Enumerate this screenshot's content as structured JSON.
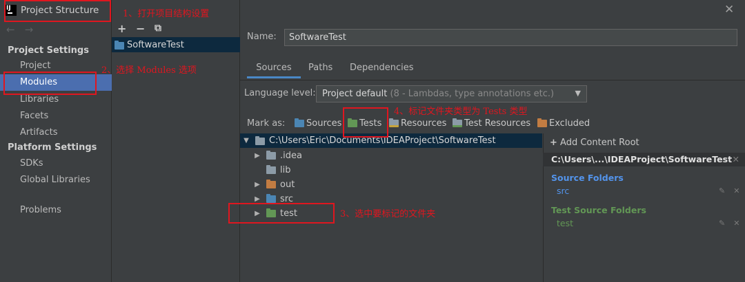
{
  "window": {
    "title": "Project Structure",
    "close_glyph": "✕"
  },
  "nav": {
    "back_glyph": "←",
    "forward_glyph": "→",
    "project_settings_header": "Project Settings",
    "project_settings_items": [
      "Project",
      "Modules",
      "Libraries",
      "Facets",
      "Artifacts"
    ],
    "platform_settings_header": "Platform Settings",
    "platform_settings_items": [
      "SDKs",
      "Global Libraries"
    ],
    "problems": "Problems",
    "selected": "Modules"
  },
  "module_list": {
    "toolbar": {
      "add": "+",
      "remove": "−",
      "copy": "⧉"
    },
    "modules": [
      "SoftwareTest"
    ]
  },
  "module_detail": {
    "name_label": "Name:",
    "name_value": "SoftwareTest",
    "tabs": [
      "Sources",
      "Paths",
      "Dependencies"
    ],
    "active_tab": "Sources",
    "language_level_label": "Language level:",
    "language_level_value": "Project default",
    "language_level_hint": " (8 - Lambdas, type annotations etc.)",
    "mark_as_label": "Mark as:",
    "mark_as_options": [
      {
        "label": "Sources",
        "icon": "source-folder-icon",
        "color": "#4b86b4"
      },
      {
        "label": "Tests",
        "icon": "test-folder-icon",
        "color": "#629755"
      },
      {
        "label": "Resources",
        "icon": "resource-folder-icon",
        "color": "#8c9ba7"
      },
      {
        "label": "Test Resources",
        "icon": "test-resource-folder-icon",
        "color": "#8c9ba7"
      },
      {
        "label": "Excluded",
        "icon": "excluded-folder-icon",
        "color": "#c27c42"
      }
    ]
  },
  "tree": {
    "root": "C:\\Users\\Eric\\Documents\\IDEAProject\\SoftwareTest",
    "children": [
      {
        "name": ".idea",
        "expandable": true,
        "color": "#8c9ba7"
      },
      {
        "name": "lib",
        "expandable": false,
        "color": "#8c9ba7"
      },
      {
        "name": "out",
        "expandable": true,
        "color": "#c27c42"
      },
      {
        "name": "src",
        "expandable": true,
        "color": "#4b86b4"
      },
      {
        "name": "test",
        "expandable": true,
        "color": "#629755"
      }
    ]
  },
  "content_root": {
    "add_label": "Add Content Root",
    "path": "C:\\Users\\...\\IDEAProject\\SoftwareTest",
    "source_folders_title": "Source Folders",
    "source_folders": [
      "src"
    ],
    "test_source_folders_title": "Test Source Folders",
    "test_source_folders": [
      "test"
    ]
  },
  "annotations": {
    "step1": "1、打开项目结构设置",
    "step2": "2、选择 Modules 选项",
    "step3": "3、选中要标记的文件夹",
    "step4": "4、标记文件夹类型为 Tests 类型"
  },
  "colors": {
    "selection": "#4b6eaf",
    "tree_selection": "#0d293e",
    "annotation_red": "#e0161f",
    "source_title": "#5394ec",
    "test_title": "#629755"
  }
}
